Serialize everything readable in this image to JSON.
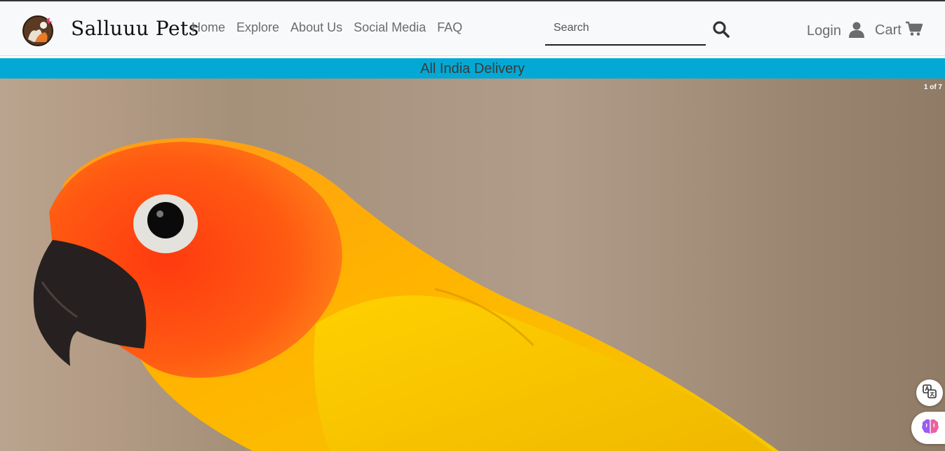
{
  "header": {
    "brand": "Salluuu Pets",
    "nav": [
      "Home",
      "Explore",
      "About Us",
      "Social Media",
      "FAQ"
    ],
    "search": {
      "placeholder": "Search",
      "value": ""
    },
    "login_label": "Login",
    "cart_label": "Cart"
  },
  "banner": {
    "text": "All India Delivery"
  },
  "carousel": {
    "counter": "1 of 7"
  },
  "icons": [
    "logo-icon",
    "search-icon",
    "user-icon",
    "cart-icon",
    "translate-icon",
    "brain-icon"
  ],
  "colors": {
    "banner": "#03a9d4",
    "header_bg": "#f8f9fa",
    "nav_text": "#6c6c6c"
  }
}
